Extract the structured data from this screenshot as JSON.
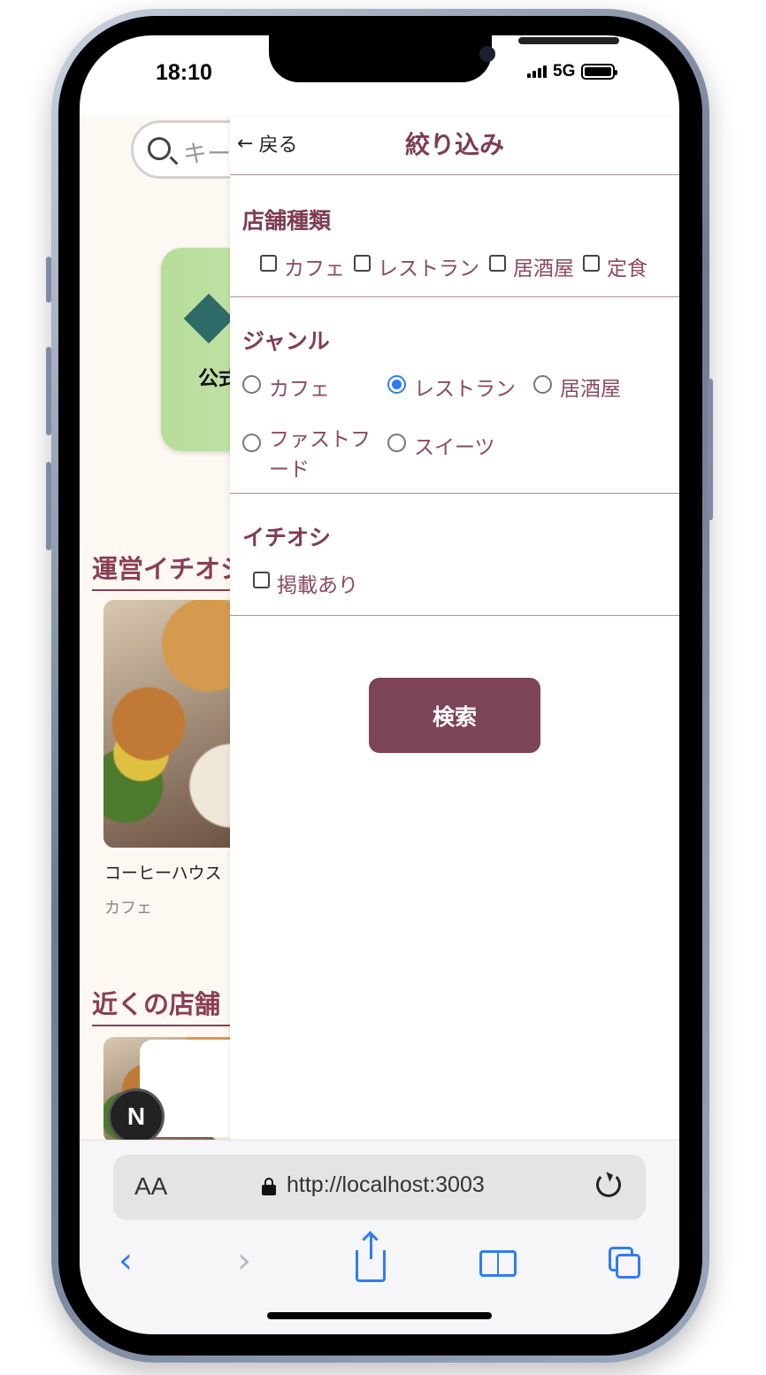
{
  "status_bar": {
    "time": "18:10",
    "network": "5G"
  },
  "background_page": {
    "search_placeholder": "キーワード",
    "card_text": "公式",
    "section_recommend": "運営イチオシ",
    "shop": {
      "name": "コーヒーハウス",
      "category": "カフェ"
    },
    "section_nearby": "近くの店舗",
    "badge": "N"
  },
  "filter_panel": {
    "back_label": "戻る",
    "title": "絞り込み",
    "store_type": {
      "heading": "店舗種類",
      "options": [
        "カフェ",
        "レストラン",
        "居酒屋",
        "定食"
      ]
    },
    "genre": {
      "heading": "ジャンル",
      "options": [
        "カフェ",
        "レストラン",
        "居酒屋",
        "ファストフード",
        "スイーツ"
      ],
      "selected": "レストラン"
    },
    "featured": {
      "heading": "イチオシ",
      "option": "掲載あり"
    },
    "search_button": "検索"
  },
  "browser": {
    "text_size_label": "AA",
    "url": "http://localhost:3003"
  }
}
